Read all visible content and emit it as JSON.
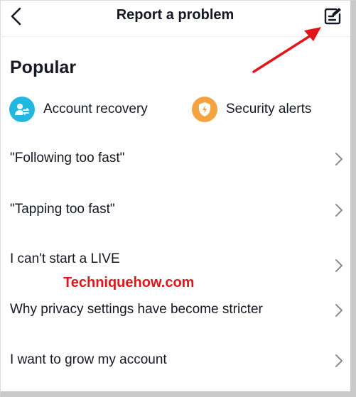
{
  "header": {
    "title": "Report a problem",
    "back_icon": "chevron-left-icon",
    "feedback_icon": "edit-note-icon"
  },
  "popular": {
    "heading": "Popular",
    "chips": [
      {
        "label": "Account recovery",
        "icon": "account-recovery-icon",
        "color": "#20b8e0"
      },
      {
        "label": "Security alerts",
        "icon": "shield-bolt-icon",
        "color": "#f4a340"
      }
    ]
  },
  "topics": [
    {
      "label": "\"Following too fast\""
    },
    {
      "label": "\"Tapping too fast\""
    },
    {
      "label": "I can't start a LIVE"
    },
    {
      "label": "Why privacy settings have become stricter"
    },
    {
      "label": "I want to grow my account"
    }
  ],
  "watermark": "Techniquehow.com",
  "colors": {
    "annotation_arrow": "#e0161b",
    "chevron": "#8a8b91"
  }
}
